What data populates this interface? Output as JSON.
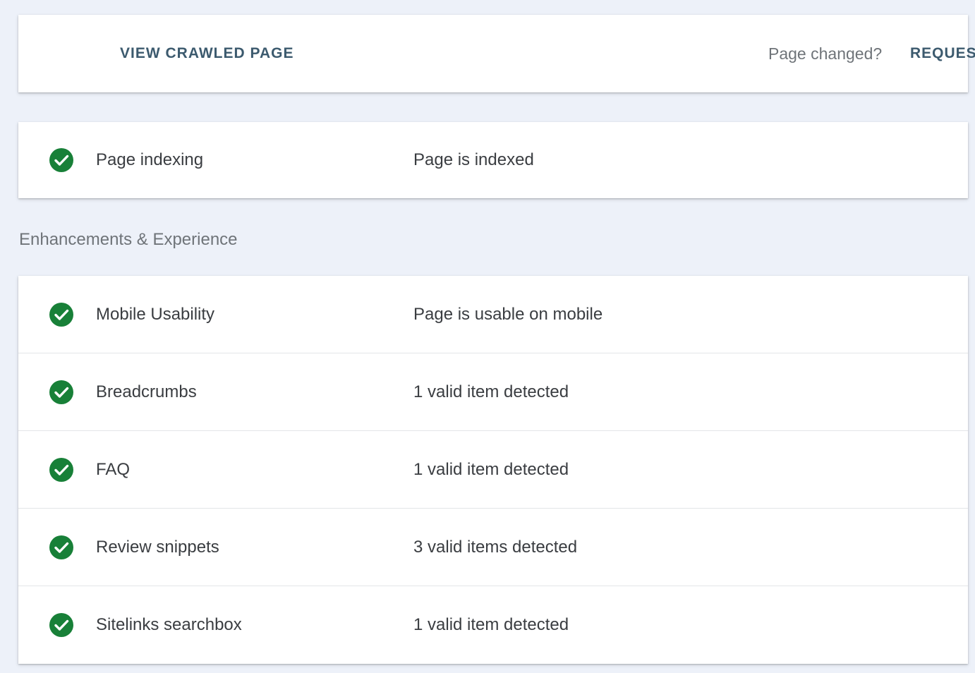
{
  "top_bar": {
    "view_crawled_label": "VIEW CRAWLED PAGE",
    "page_changed_text": "Page changed?",
    "request_label": "REQUES"
  },
  "indexing": {
    "label": "Page indexing",
    "value": "Page is indexed",
    "status_icon": "check-circle-icon"
  },
  "enhancements": {
    "heading": "Enhancements & Experience",
    "rows": [
      {
        "label": "Mobile Usability",
        "value": "Page is usable on mobile",
        "status_icon": "check-circle-icon"
      },
      {
        "label": "Breadcrumbs",
        "value": "1 valid item detected",
        "status_icon": "check-circle-icon"
      },
      {
        "label": "FAQ",
        "value": "1 valid item detected",
        "status_icon": "check-circle-icon"
      },
      {
        "label": "Review snippets",
        "value": "3 valid items detected",
        "status_icon": "check-circle-icon"
      },
      {
        "label": "Sitelinks searchbox",
        "value": "1 valid item detected",
        "status_icon": "check-circle-icon"
      }
    ]
  },
  "colors": {
    "background": "#edf1f9",
    "card": "#ffffff",
    "success_green": "#188038",
    "action_text": "#3c5a6e",
    "body_text": "#3a3d41",
    "muted_text": "#6f7479"
  }
}
